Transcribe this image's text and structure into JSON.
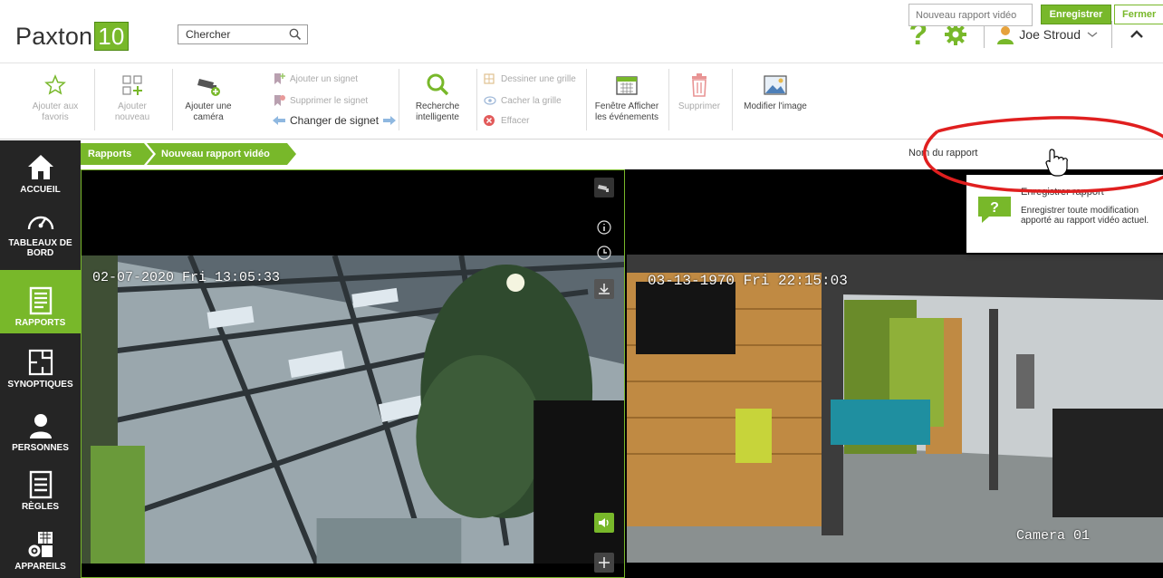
{
  "header": {
    "logo_text": "Paxton",
    "logo_version": "10",
    "search_value": "Chercher",
    "help_symbol": "?",
    "user_name": "Joe Stroud"
  },
  "ribbon": {
    "add_favorites": "Ajouter aux favoris",
    "add_new": "Ajouter nouveau",
    "add_camera": "Ajouter une caméra",
    "add_bookmark": "Ajouter un signet",
    "remove_bookmark": "Supprimer le signet",
    "change_bookmark": "Changer de signet",
    "smart_search": "Recherche intelligente",
    "draw_grid": "Dessiner une grille",
    "hide_grid": "Cacher la grille",
    "clear": "Effacer",
    "events_window": "Fenêtre Afficher les événements",
    "delete": "Supprimer",
    "edit_image": "Modifier l'image"
  },
  "nav": {
    "items": [
      {
        "label": "ACCUEIL"
      },
      {
        "label": "TABLEAUX DE BORD"
      },
      {
        "label": "RAPPORTS"
      },
      {
        "label": "SYNOPTIQUES"
      },
      {
        "label": "PERSONNES"
      },
      {
        "label": "RÈGLES"
      },
      {
        "label": "APPAREILS"
      }
    ]
  },
  "breadcrumb": {
    "items": [
      "Rapports",
      "Nouveau rapport vidéo"
    ]
  },
  "report": {
    "name_label": "Nom du rapport",
    "name_placeholder": "Nouveau rapport vidéo",
    "save_label": "Enregistrer",
    "close_label": "Fermer"
  },
  "tooltip": {
    "title": "Enregistrer rapport",
    "description": "Enregistrer toute modification apporté au rapport vidéo actuel."
  },
  "video": {
    "left_timestamp": "02-07-2020 Fri 13:05:33",
    "right_timestamp": "03-13-1970 Fri 22:15:03",
    "right_camera_label": "Camera 01"
  },
  "colors": {
    "accent": "#78b82a",
    "nav_bg": "#252525",
    "highlight_ellipse": "#e01f1f"
  }
}
